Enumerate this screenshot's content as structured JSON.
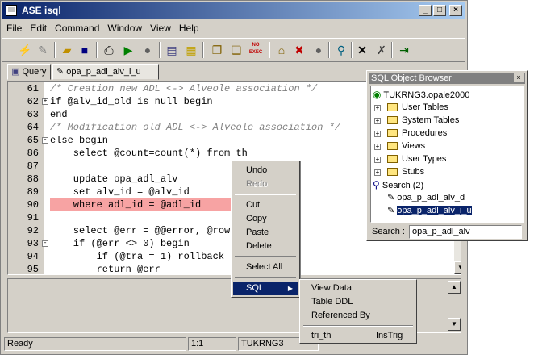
{
  "window": {
    "title": "ASE isql",
    "min": "_",
    "max": "□",
    "close": "×"
  },
  "menu": [
    "File",
    "Edit",
    "Command",
    "Window",
    "View",
    "Help"
  ],
  "toolbar": {
    "noexec_label": "NO EXEC"
  },
  "tabs": [
    {
      "label": "Query"
    },
    {
      "label": "opa_p_adl_alv_i_u"
    }
  ],
  "editor": {
    "lines": [
      {
        "num": "61",
        "text": "/* Creation new ADL <-> Alveole association */",
        "style": "comment"
      },
      {
        "num": "62",
        "text": "if @alv_id_old is null begin",
        "style": "normal"
      },
      {
        "num": "63",
        "text": "end",
        "style": "normal"
      },
      {
        "num": "64",
        "text": "/* Modification old ADL <-> Alveole association */",
        "style": "comment"
      },
      {
        "num": "65",
        "text": "else begin",
        "style": "normal"
      },
      {
        "num": "86",
        "text": "    select @count=count(*) from th",
        "style": "normal"
      },
      {
        "num": "87",
        "text": "",
        "style": "normal"
      },
      {
        "num": "88",
        "text": "    update opa_adl_alv",
        "style": "normal"
      },
      {
        "num": "89",
        "text": "    set alv_id = @alv_id",
        "style": "normal"
      },
      {
        "num": "90",
        "text": "    where adl_id = @adl_id",
        "style": "highlight"
      },
      {
        "num": "91",
        "text": "",
        "style": "normal"
      },
      {
        "num": "92",
        "text": "    select @err = @@error, @row",
        "style": "normal"
      },
      {
        "num": "93",
        "text": "    if (@err <> 0) begin",
        "style": "normal"
      },
      {
        "num": "94",
        "text": "        if (@tra = 1) rollback t",
        "style": "normal"
      },
      {
        "num": "95",
        "text": "        return @err",
        "style": "normal"
      }
    ]
  },
  "context_menu": {
    "undo": "Undo",
    "redo": "Redo",
    "cut": "Cut",
    "copy": "Copy",
    "paste": "Paste",
    "delete": "Delete",
    "select_all": "Select All",
    "sql": "SQL"
  },
  "sql_submenu": {
    "view_data": "View Data",
    "table_ddl": "Table DDL",
    "referenced_by": "Referenced By",
    "tri_th": "tri_th",
    "instrig": "InsTrig"
  },
  "object_browser": {
    "title": "SQL Object Browser",
    "server": "TUKRNG3.opale2000",
    "nodes": [
      "User Tables",
      "System Tables",
      "Procedures",
      "Views",
      "User Types",
      "Stubs"
    ],
    "search_label": "Search (2)",
    "results": [
      "opa_p_adl_alv_d",
      "opa_p_adl_alv_i_u"
    ],
    "search_field_label": "Search :",
    "search_value": "opa_p_adl_alv"
  },
  "status": {
    "ready": "Ready",
    "position": "1:1",
    "server": "TUKRNG3"
  }
}
